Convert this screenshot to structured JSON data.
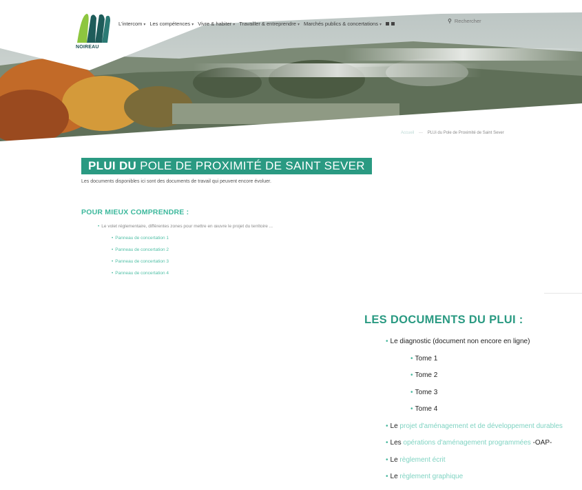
{
  "logo": {
    "name": "NOIREAU",
    "tagline": ""
  },
  "nav": {
    "items": [
      "L'intercom",
      "Les compétences",
      "Vivre & habiter",
      "Travailler & entreprendre",
      "Marchés publics & concertations"
    ]
  },
  "search": {
    "placeholder": "Rechercher"
  },
  "breadcrumb": {
    "home": "Accueil",
    "current": "PLUi du Pole de Proximité de Saint Sever"
  },
  "page": {
    "title_strong": "PLUI DU",
    "title_rest": "POLE DE PROXIMITÉ DE SAINT SEVER",
    "intro": "Les documents disponibles ici sont des documents de travail qui peuvent encore évoluer."
  },
  "understand": {
    "heading": "POUR MIEUX COMPRENDRE :",
    "lead": "Le volet réglementaire, différentes zones pour mettre en œuvre le projet du territoire ...",
    "panels": [
      "Panneau de concertation 1",
      "Panneau de concertation 2",
      "Panneau de concertation 3",
      "Panneau de concertation 4"
    ]
  },
  "documents": {
    "heading": "LES DOCUMENTS DU PLUI :",
    "diagnostic": "Le diagnostic (document non encore en ligne)",
    "tomes": [
      "Tome 1",
      "Tome 2",
      "Tome 3",
      "Tome 4"
    ],
    "padd_prefix": "Le",
    "padd_link": "projet d'aménagement et de développement durables",
    "oap_prefix": "Les",
    "oap_link": "opérations d'aménagement programmées",
    "oap_suffix": "-OAP-",
    "reg_ecrit_prefix": "Le",
    "reg_ecrit_link": "règlement écrit",
    "reg_graph_prefix": "Le",
    "reg_graph_link": "règlement graphique"
  },
  "colors": {
    "accent": "#2a9a82",
    "accent_light": "#3cb89c",
    "link": "#7fd3c2"
  }
}
